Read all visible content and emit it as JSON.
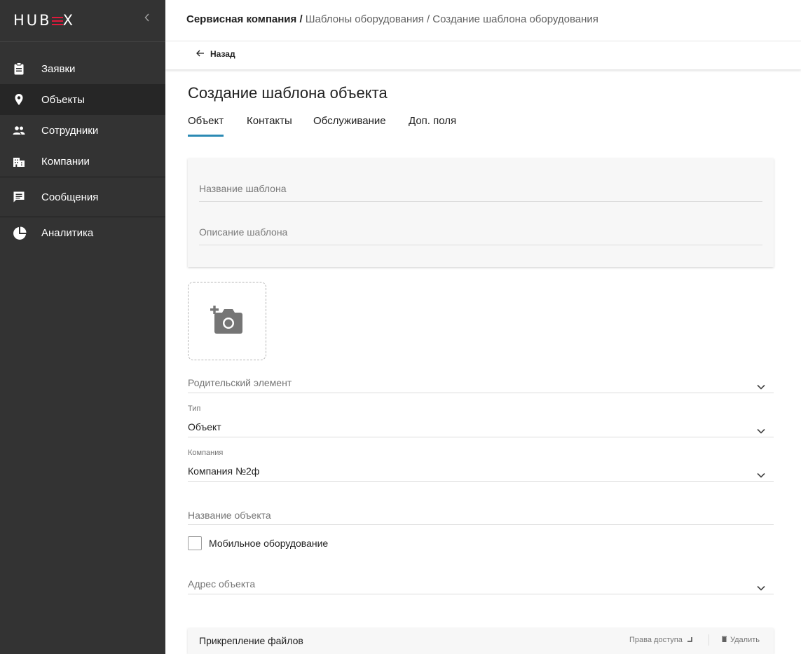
{
  "app": {
    "logo_text": "HUBEX"
  },
  "sidebar": {
    "items": [
      {
        "label": "Заявки",
        "icon": "clipboard-icon"
      },
      {
        "label": "Объекты",
        "icon": "location-pin-icon",
        "active": true
      },
      {
        "label": "Сотрудники",
        "icon": "people-icon"
      },
      {
        "label": "Компании",
        "icon": "buildings-icon"
      },
      {
        "label": "Сообщения",
        "icon": "chat-icon"
      },
      {
        "label": "Аналитика",
        "icon": "pie-chart-icon"
      }
    ]
  },
  "header": {
    "breadcrumb": [
      "Сервисная компания",
      "Шаблоны оборудования",
      "Создание шаблона оборудования"
    ],
    "back_label": "Назад"
  },
  "main": {
    "title": "Создание шаблона объекта",
    "tabs": [
      {
        "label": "Объект",
        "active": true
      },
      {
        "label": "Контакты"
      },
      {
        "label": "Обслуживание"
      },
      {
        "label": "Доп. поля"
      }
    ],
    "template_name_placeholder": "Название шаблона",
    "template_description_placeholder": "Описание шаблона",
    "parent_placeholder": "Родительский элемент",
    "type": {
      "label": "Тип",
      "value": "Объект"
    },
    "company": {
      "label": "Компания",
      "value": "Компания №2ф"
    },
    "object_name_placeholder": "Название объекта",
    "mobile_equipment": {
      "label": "Мобильное оборудование",
      "checked": false
    },
    "address_placeholder": "Адрес объекта",
    "attachments": {
      "title": "Прикрепление файлов",
      "rights_label": "Права доступа",
      "delete_label": "Удалить"
    }
  },
  "colors": {
    "sidebar_bg": "#333333",
    "active_item_bg": "#262626",
    "accent": "#2b8ab4",
    "logo_accent": "#e0193b"
  }
}
